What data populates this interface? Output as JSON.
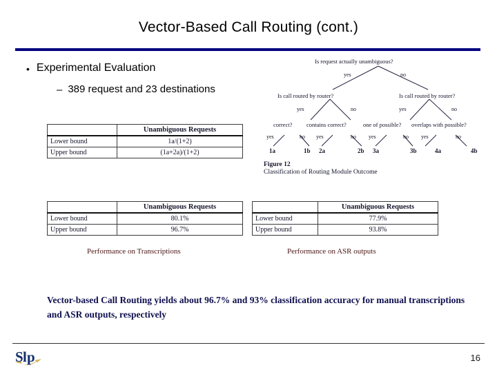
{
  "slide": {
    "title": "Vector-Based Call Routing (cont.)",
    "page_number": "16",
    "accent_color": "#000080",
    "caption_color": "#4a1414",
    "conclusion_color": "#101050"
  },
  "bullets": {
    "marker_level1": "•",
    "marker_level2": "–",
    "level1": "Experimental Evaluation",
    "level2": "389 request and 23 destinations"
  },
  "figure": {
    "caption_line1": "Figure 12",
    "caption_line2": "Classification of Routing Module Outcome",
    "root": "Is request actually unambiguous?",
    "root_branches": [
      "yes",
      "no"
    ],
    "level2_nodes": [
      "Is call routed by router?",
      "Is call routed by router?"
    ],
    "level2_branches": [
      "yes",
      "no",
      "yes",
      "no"
    ],
    "level3_nodes": [
      "correct?",
      "contains correct?",
      "one of possible?",
      "overlaps with possible?"
    ],
    "level3_branches": [
      "yes",
      "no",
      "yes",
      "no",
      "yes",
      "no",
      "yes",
      "no"
    ],
    "leaves": [
      "1a",
      "1b",
      "2a",
      "2b",
      "3a",
      "3b",
      "4a",
      "4b"
    ]
  },
  "tables": {
    "formula": {
      "corner": "",
      "header": "Unambiguous Requests",
      "rows": [
        {
          "label": "Lower bound",
          "value": "1a/(1+2)"
        },
        {
          "label": "Upper bound",
          "value": "(1a+2a)/(1+2)"
        }
      ]
    },
    "transcription": {
      "corner": "",
      "header": "Unambiguous Requests",
      "rows": [
        {
          "label": "Lower bound",
          "value": "80.1%"
        },
        {
          "label": "Upper bound",
          "value": "96.7%"
        }
      ],
      "caption": "Performance on Transcriptions"
    },
    "asr": {
      "corner": "",
      "header": "Unambiguous Requests",
      "rows": [
        {
          "label": "Lower bound",
          "value": "77.9%"
        },
        {
          "label": "Upper bound",
          "value": "93.8%"
        }
      ],
      "caption": "Performance on ASR outputs"
    }
  },
  "conclusion": "Vector-based Call Routing yields about 96.7% and 93% classification accuracy for manual transcriptions and ASR outputs, respectively",
  "logo": {
    "name": "slp-logo",
    "text": "SLP"
  }
}
